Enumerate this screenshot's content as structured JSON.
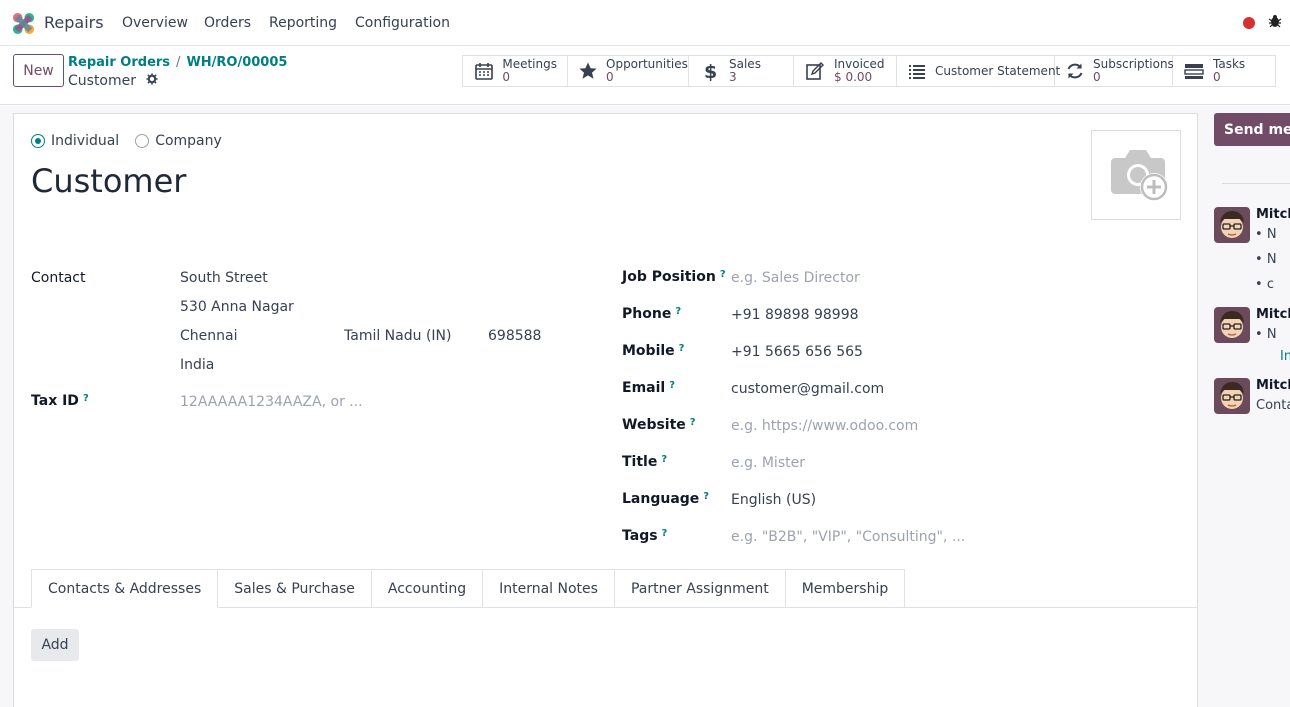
{
  "navbar": {
    "app_name": "Repairs",
    "menu": [
      "Overview",
      "Orders",
      "Reporting",
      "Configuration"
    ]
  },
  "control": {
    "new_label": "New",
    "breadcrumb": [
      "Repair Orders",
      "WH/RO/00005"
    ],
    "breadcrumb_sep": "/",
    "record_title": "Customer",
    "stats": [
      {
        "icon": "calendar-icon",
        "label": "Meetings",
        "value": "0"
      },
      {
        "icon": "star-icon",
        "label": "Opportunities",
        "value": "0"
      },
      {
        "icon": "dollar-icon",
        "label": "Sales",
        "value": "3"
      },
      {
        "icon": "invoice-icon",
        "label": "Invoiced",
        "value": "$ 0.00"
      },
      {
        "icon": "list-icon",
        "label": "Customer Statement",
        "value": ""
      },
      {
        "icon": "refresh-icon",
        "label": "Subscriptions",
        "value": "0"
      },
      {
        "icon": "tasks-icon",
        "label": "Tasks",
        "value": "0"
      }
    ]
  },
  "form": {
    "type_individual": "Individual",
    "type_company": "Company",
    "selected_type": "Individual",
    "name": "Customer",
    "contact_label": "Contact",
    "address": {
      "street": "South Street",
      "street2": "530 Anna Nagar",
      "city": "Chennai",
      "state": "Tamil Nadu (IN)",
      "zip": "698588",
      "country": "India"
    },
    "tax_id_label": "Tax ID",
    "tax_id_placeholder": "12AAAAA1234AAZA, or ...",
    "job_position_label": "Job Position",
    "job_position_placeholder": "e.g. Sales Director",
    "phone_label": "Phone",
    "phone": "+91 89898 98998",
    "mobile_label": "Mobile",
    "mobile": "+91 5665 656 565",
    "email_label": "Email",
    "email": "customer@gmail.com",
    "website_label": "Website",
    "website_placeholder": "e.g. https://www.odoo.com",
    "title_label": "Title",
    "title_placeholder": "e.g. Mister",
    "language_label": "Language",
    "language": "English (US)",
    "tags_label": "Tags",
    "tags_placeholder": "e.g. \"B2B\", \"VIP\", \"Consulting\", ...",
    "help_mark": "?",
    "tabs": [
      "Contacts & Addresses",
      "Sales & Purchase",
      "Accounting",
      "Internal Notes",
      "Partner Assignment",
      "Membership"
    ],
    "active_tab": "Contacts & Addresses",
    "add_label": "Add"
  },
  "chatter": {
    "send_label": "Send mess",
    "messages": [
      {
        "author": "Mitch",
        "bullets": [
          "N",
          "N",
          "c"
        ]
      },
      {
        "author": "Mitch",
        "bullets": [
          "N"
        ],
        "link": "In"
      },
      {
        "author": "Mitch",
        "body": "Conta"
      }
    ]
  },
  "colors": {
    "brand": "#714b67",
    "accent": "#017e84",
    "record_dot": "#d63030"
  }
}
